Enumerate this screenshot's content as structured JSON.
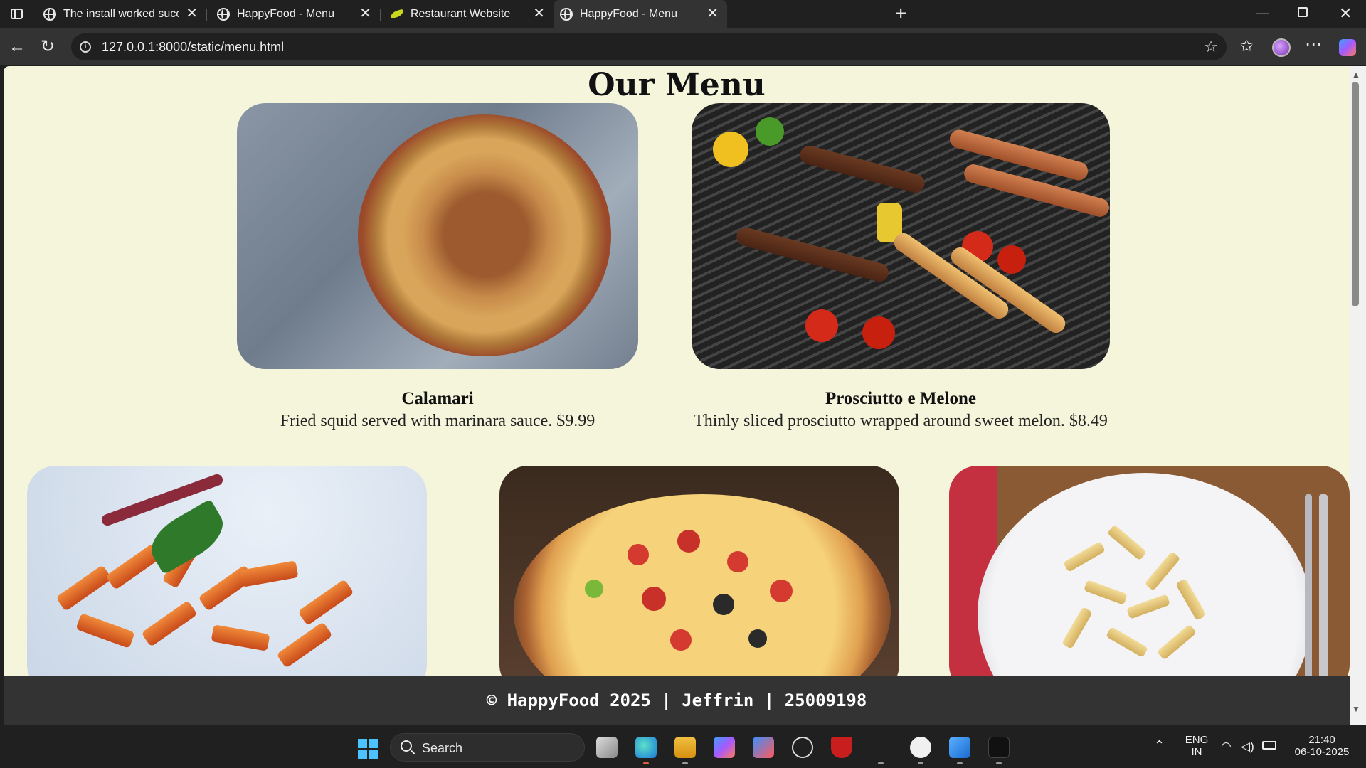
{
  "browser": {
    "tabs": [
      {
        "title": "The install worked successfully! C",
        "icon": "globe-icon"
      },
      {
        "title": "HappyFood - Menu",
        "icon": "globe-icon"
      },
      {
        "title": "Restaurant Website",
        "icon": "leaf-icon"
      },
      {
        "title": "HappyFood - Menu",
        "icon": "globe-icon",
        "active": true
      }
    ],
    "url": "127.0.0.1:8000/static/menu.html"
  },
  "page": {
    "title": "Our Menu",
    "items": [
      {
        "name": "Calamari",
        "description": "Fried squid served with marinara sauce. $9.99",
        "image": "spaghetti-bolognese-photo"
      },
      {
        "name": "Prosciutto e Melone",
        "description": "Thinly sliced prosciutto wrapped around sweet melon. $8.49",
        "image": "bbq-grill-photo"
      },
      {
        "image": "penne-arrabbiata-photo"
      },
      {
        "image": "pizza-photo"
      },
      {
        "image": "creamy-penne-photo"
      }
    ],
    "footer": "© HappyFood 2025 | Jeffrin | 25009198",
    "background_color": "#f5f5dc",
    "footer_color": "#333333"
  },
  "taskbar": {
    "search_label": "Search",
    "lang_top": "ENG",
    "lang_bottom": "IN",
    "time": "21:40",
    "date": "06-10-2025"
  }
}
